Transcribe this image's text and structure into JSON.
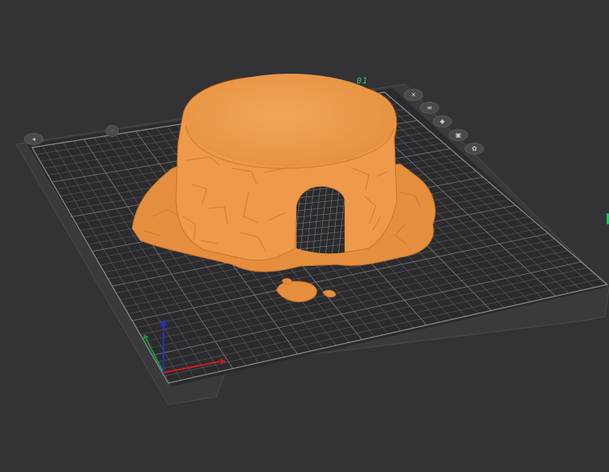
{
  "plate": {
    "label": "01"
  },
  "plate_controls": [
    {
      "name": "close-icon",
      "glyph": "✕"
    },
    {
      "name": "arrange-icon",
      "glyph": "≡"
    },
    {
      "name": "orient-icon",
      "glyph": "◆"
    },
    {
      "name": "lock-icon",
      "glyph": "▣"
    },
    {
      "name": "settings-icon",
      "glyph": "✿"
    }
  ],
  "colors": {
    "background": "#333335",
    "plate": "#2b2b2d",
    "grid": "#7b7b7e",
    "model": "#ef9a4a",
    "model_shadow": "#c7742c",
    "axis_x": "#c81e1e",
    "axis_y": "#1f8f2e",
    "axis_z": "#1f2fc8",
    "plate_label": "#2fd06a"
  }
}
